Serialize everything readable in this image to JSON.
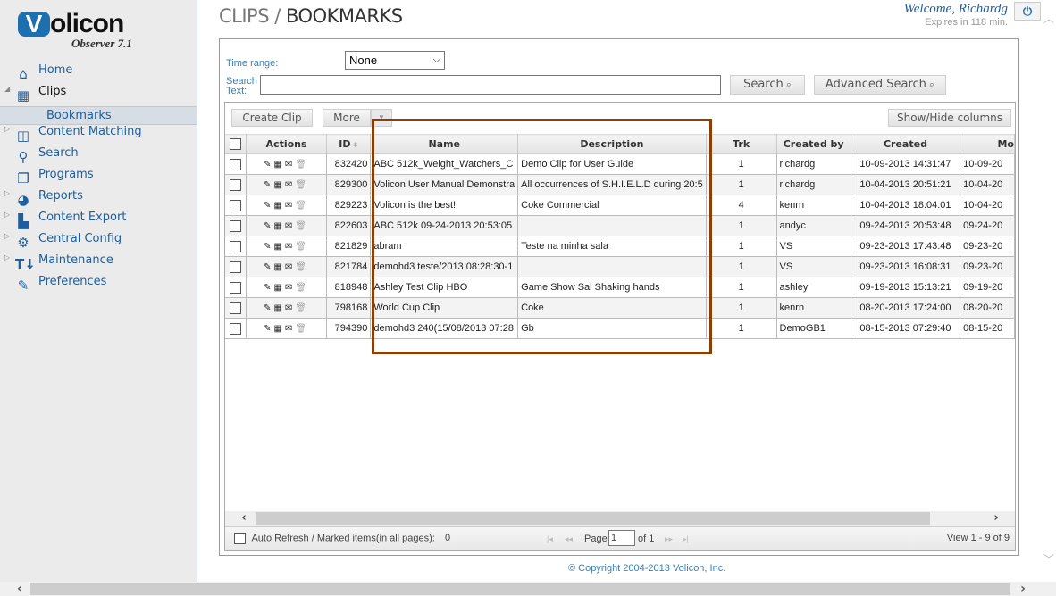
{
  "app": {
    "logo_mark": "V",
    "logo_text": "olicon",
    "product": "Observer 7.1",
    "brand_color": "#1e6fb0"
  },
  "header": {
    "crumb_parent": "CLIPS",
    "crumb_sep": " / ",
    "crumb_current": "BOOKMARKS",
    "welcome": "Welcome, Richardg",
    "expires": "Expires in 118 min.",
    "power_icon": "power-icon"
  },
  "sidebar": {
    "items": [
      {
        "label": "Home",
        "icon": "home-icon",
        "glyph": "⌂"
      },
      {
        "label": "Clips",
        "icon": "film-icon",
        "glyph": "▦",
        "expanded": true
      },
      {
        "label": "Bookmarks",
        "sub": true,
        "selected": true
      },
      {
        "label": "Content Matching",
        "icon": "content-matching-icon",
        "glyph": "◫",
        "collapsed": true
      },
      {
        "label": "Search",
        "icon": "search-icon",
        "glyph": "🔍"
      },
      {
        "label": "Programs",
        "icon": "programs-icon",
        "glyph": "❐"
      },
      {
        "label": "Reports",
        "icon": "pie-chart-icon",
        "glyph": "◕",
        "collapsed": true
      },
      {
        "label": "Content Export",
        "icon": "clapperboard-icon",
        "glyph": "▬",
        "collapsed": true
      },
      {
        "label": "Central Config",
        "icon": "gear-icon",
        "glyph": "⚙",
        "collapsed": true
      },
      {
        "label": "Maintenance",
        "icon": "tools-icon",
        "glyph": "T",
        "collapsed": true
      },
      {
        "label": "Preferences",
        "icon": "wrench-icon",
        "glyph": "🔧"
      }
    ]
  },
  "filters": {
    "time_range_label": "Time range:",
    "time_range_value": "None",
    "search_text_label_1": "Search",
    "search_text_label_2": "Text:",
    "search_text_value": "",
    "search_button": "Search",
    "advanced_search_button": "Advanced Search"
  },
  "toolbar": {
    "create_clip": "Create Clip",
    "more": "More",
    "show_hide_columns": "Show/Hide columns"
  },
  "table": {
    "columns": [
      "",
      "Actions",
      "ID",
      "Name",
      "Description",
      "Trk",
      "Created by",
      "Created",
      "Mo"
    ],
    "rows": [
      {
        "id": "832420",
        "name": "ABC 512k_Weight_Watchers_C",
        "description": "Demo Clip for User Guide",
        "trk": "1",
        "created_by": "richardg",
        "created": "10-09-2013 14:31:47",
        "modified": "10-09-20"
      },
      {
        "id": "829300",
        "name": "Volicon User Manual Demonstra",
        "description": "All occurrences of S.H.I.E.L.D during 20:5",
        "trk": "1",
        "created_by": "richardg",
        "created": "10-04-2013 20:51:21",
        "modified": "10-04-20"
      },
      {
        "id": "829223",
        "name": "Volicon is the best!",
        "description": "Coke Commercial",
        "trk": "4",
        "created_by": "kenrn",
        "created": "10-04-2013 18:04:01",
        "modified": "10-04-20"
      },
      {
        "id": "822603",
        "name": "ABC 512k 09-24-2013 20:53:05",
        "description": "",
        "trk": "1",
        "created_by": "andyc",
        "created": "09-24-2013 20:53:48",
        "modified": "09-24-20"
      },
      {
        "id": "821829",
        "name": "abram",
        "description": "Teste na minha sala",
        "trk": "1",
        "created_by": "VS",
        "created": "09-23-2013 17:43:48",
        "modified": "09-23-20"
      },
      {
        "id": "821784",
        "name": "demohd3 teste/2013 08:28:30-1",
        "description": "",
        "trk": "1",
        "created_by": "VS",
        "created": "09-23-2013 16:08:31",
        "modified": "09-23-20"
      },
      {
        "id": "818948",
        "name": "Ashley Test Clip HBO",
        "description": "Game Show Sal Shaking hands",
        "trk": "1",
        "created_by": "ashley",
        "created": "09-19-2013 15:13:21",
        "modified": "09-19-20"
      },
      {
        "id": "798168",
        "name": "World Cup Clip",
        "description": "Coke",
        "trk": "1",
        "created_by": "kenrn",
        "created": "08-20-2013 17:24:00",
        "modified": "08-20-20"
      },
      {
        "id": "794390",
        "name": "demohd3 240(15/08/2013 07:28",
        "description": "Gb",
        "trk": "1",
        "created_by": "DemoGB1",
        "created": "08-15-2013 07:29:40",
        "modified": "08-15-20"
      }
    ],
    "row_actions": [
      "edit-icon",
      "film-icon",
      "email-icon",
      "trash-icon"
    ]
  },
  "pager": {
    "auto_refresh": "Auto Refresh / Marked items(in all pages):",
    "marked_count": "0",
    "page_label": "Page",
    "page_value": "1",
    "of_label": "of 1",
    "view": "View 1 - 9 of 9"
  },
  "footer": {
    "copyright": "© Copyright 2004-2013 Volicon, Inc."
  },
  "highlight": {
    "color": "#8b3f07"
  }
}
